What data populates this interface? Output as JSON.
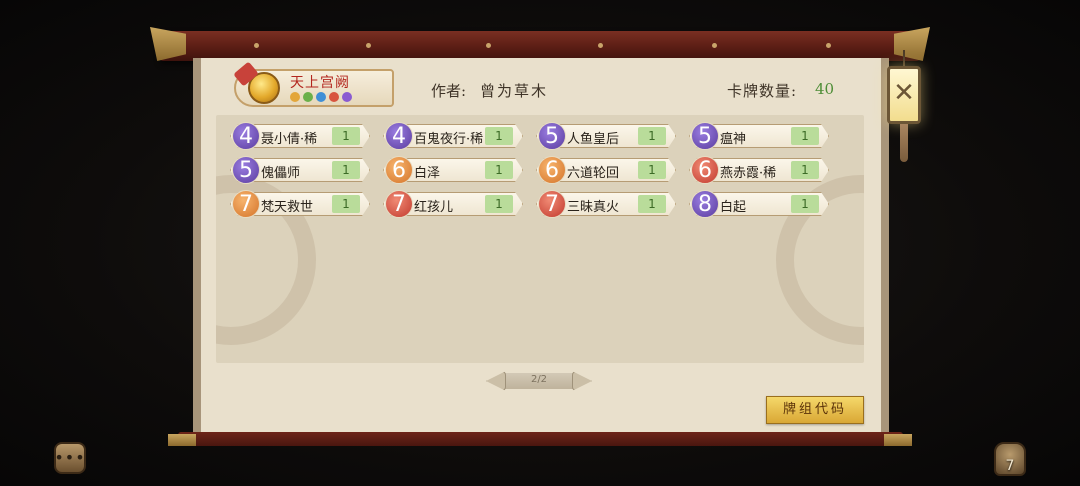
{
  "deck": {
    "title": "天上宫阙",
    "author_label": "作者:",
    "author_name": "曾为草木",
    "card_count_label": "卡牌数量:",
    "card_count_value": "40",
    "element_dots": [
      "#e3a63a",
      "#6bb04a",
      "#3f8fd6",
      "#d8553f",
      "#8a5bd1"
    ]
  },
  "cards": [
    {
      "cost": "4",
      "color": "purple",
      "name": "聂小倩·稀",
      "count": "1"
    },
    {
      "cost": "4",
      "color": "purple",
      "name": "百鬼夜行·稀",
      "count": "1"
    },
    {
      "cost": "5",
      "color": "purple",
      "name": "人鱼皇后",
      "count": "1"
    },
    {
      "cost": "5",
      "color": "purple",
      "name": "瘟神",
      "count": "1"
    },
    {
      "cost": "5",
      "color": "purple",
      "name": "傀儡师",
      "count": "1"
    },
    {
      "cost": "6",
      "color": "orange",
      "name": "白泽",
      "count": "1"
    },
    {
      "cost": "6",
      "color": "orange",
      "name": "六道轮回",
      "count": "1"
    },
    {
      "cost": "6",
      "color": "red",
      "name": "燕赤霞·稀",
      "count": "1"
    },
    {
      "cost": "7",
      "color": "orange",
      "name": "梵天救世",
      "count": "1"
    },
    {
      "cost": "7",
      "color": "red",
      "name": "红孩儿",
      "count": "1"
    },
    {
      "cost": "7",
      "color": "red",
      "name": "三昧真火",
      "count": "1"
    },
    {
      "cost": "8",
      "color": "purple",
      "name": "白起",
      "count": "1"
    }
  ],
  "pager": {
    "text": "2/2"
  },
  "buttons": {
    "deck_code": "牌组代码",
    "close": "✕"
  },
  "corner": {
    "chat_icon": "•••",
    "bag_count": "7"
  }
}
